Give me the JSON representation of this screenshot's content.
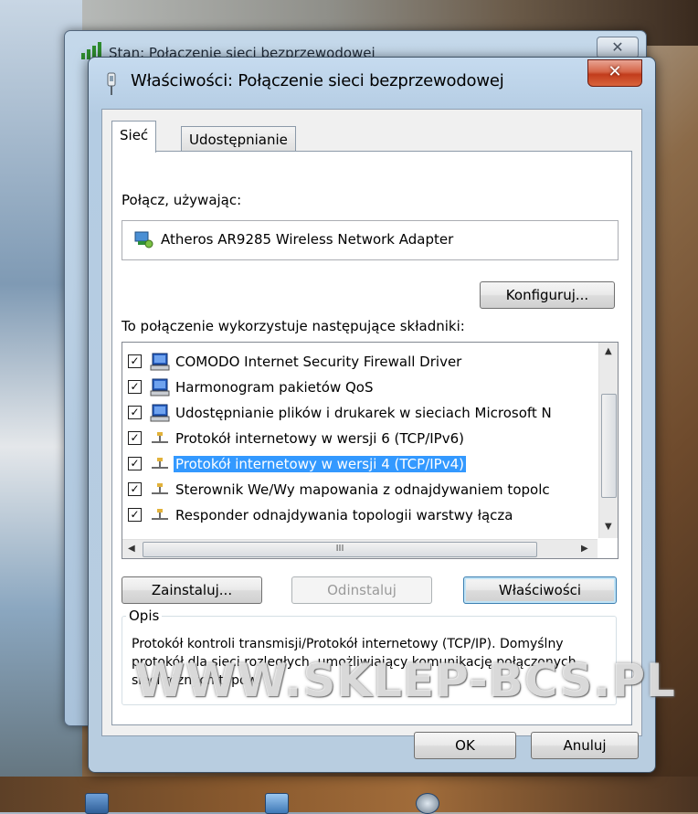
{
  "background_window": {
    "title": "Stan: Połączenie sieci bezprzewodowej",
    "close_glyph": "✕"
  },
  "dialog": {
    "title": "Właściwości: Połączenie sieci bezprzewodowej",
    "close_glyph": "✕",
    "icon": "network-adapter-icon"
  },
  "tabs": [
    {
      "label": "Sieć",
      "active": true
    },
    {
      "label": "Udostępnianie",
      "active": false
    }
  ],
  "connect_using_label": "Połącz, używając:",
  "adapter": {
    "name": "Atheros AR9285 Wireless Network Adapter",
    "icon": "network-card-icon"
  },
  "configure_button": "Konfiguruj...",
  "components_label": "To połączenie wykorzystuje następujące składniki:",
  "components": [
    {
      "label": "COMODO Internet Security Firewall Driver",
      "checked": true,
      "icon": "network-client-icon",
      "selected": false
    },
    {
      "label": "Harmonogram pakietów QoS",
      "checked": true,
      "icon": "network-client-icon",
      "selected": false
    },
    {
      "label": "Udostępnianie plików i drukarek w sieciach Microsoft N",
      "checked": true,
      "icon": "network-client-icon",
      "selected": false
    },
    {
      "label": "Protokół internetowy w wersji 6 (TCP/IPv6)",
      "checked": true,
      "icon": "protocol-icon",
      "selected": false
    },
    {
      "label": "Protokół internetowy w wersji 4 (TCP/IPv4)",
      "checked": true,
      "icon": "protocol-icon",
      "selected": true
    },
    {
      "label": "Sterownik We/Wy mapowania z odnajdywaniem topolc",
      "checked": true,
      "icon": "protocol-icon",
      "selected": false
    },
    {
      "label": "Responder odnajdywania topologii warstwy łącza",
      "checked": true,
      "icon": "protocol-icon",
      "selected": false
    }
  ],
  "hscroll_grip": "III",
  "buttons": {
    "install": "Zainstaluj...",
    "uninstall": "Odinstaluj",
    "properties": "Właściwości",
    "ok": "OK",
    "cancel": "Anuluj"
  },
  "description": {
    "title": "Opis",
    "text": "Protokół kontroli transmisji/Protokół internetowy (TCP/IP). Domyślny protokół dla sieci rozległych, umożliwiający komunikację połączonych sieci różnych typów."
  },
  "watermark": "WWW.SKLEP-BCS.PL",
  "colors": {
    "selection": "#3399ff",
    "close_button": "#c94b2c"
  }
}
